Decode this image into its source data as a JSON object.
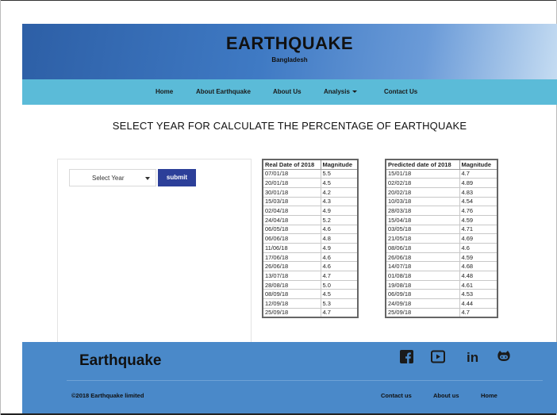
{
  "header": {
    "title": "EARTHQUAKE",
    "subtitle": "Bangladesh"
  },
  "nav": {
    "home": "Home",
    "about_earthquake": "About Earthquake",
    "about_us": "About Us",
    "analysis": "Analysis",
    "contact_us": "Contact Us"
  },
  "main": {
    "heading": "SELECT YEAR FOR CALCULATE THE PERCENTAGE OF EARTHQUAKE",
    "select_value": "Select Year",
    "submit_label": "submit"
  },
  "real_table": {
    "headers": [
      "Real Date of 2018",
      "Magnitude"
    ],
    "rows": [
      [
        "07/01/18",
        "5.5"
      ],
      [
        "20/01/18",
        "4.5"
      ],
      [
        "30/01/18",
        "4.2"
      ],
      [
        "15/03/18",
        "4.3"
      ],
      [
        "02/04/18",
        "4.9"
      ],
      [
        "24/04/18",
        "5.2"
      ],
      [
        "06/05/18",
        "4.6"
      ],
      [
        "06/06/18",
        "4.8"
      ],
      [
        "11/06/18",
        "4.9"
      ],
      [
        "17/06/18",
        "4.6"
      ],
      [
        "26/06/18",
        "4.6"
      ],
      [
        "13/07/18",
        "4.7"
      ],
      [
        "28/08/18",
        "5.0"
      ],
      [
        "08/09/18",
        "4.5"
      ],
      [
        "12/09/18",
        "5.3"
      ],
      [
        "25/09/18",
        "4.7"
      ]
    ]
  },
  "predicted_table": {
    "headers": [
      "Predicted date of 2018",
      "Magnitude"
    ],
    "rows": [
      [
        "15/01/18",
        "4.7"
      ],
      [
        "02/02/18",
        "4.89"
      ],
      [
        "20/02/18",
        "4.83"
      ],
      [
        "10/03/18",
        "4.54"
      ],
      [
        "28/03/18",
        "4.76"
      ],
      [
        "15/04/18",
        "4.59"
      ],
      [
        "03/05/18",
        "4.71"
      ],
      [
        "21/05/18",
        "4.69"
      ],
      [
        "08/06/18",
        "4.6"
      ],
      [
        "26/06/18",
        "4.59"
      ],
      [
        "14/07/18",
        "4.68"
      ],
      [
        "01/08/18",
        "4.48"
      ],
      [
        "19/08/18",
        "4.61"
      ],
      [
        "06/09/18",
        "4.53"
      ],
      [
        "24/09/18",
        "4.44"
      ],
      [
        "25/09/18",
        "4.7"
      ]
    ]
  },
  "footer": {
    "brand": "Earthquake",
    "copyright": "©2018 Earthquake limited",
    "links": {
      "contact": "Contact us",
      "about": "About us",
      "home": "Home"
    },
    "social_icons": [
      "facebook-icon",
      "youtube-icon",
      "linkedin-icon",
      "github-icon"
    ],
    "linkedin_text": "in"
  },
  "colors": {
    "nav_bar": "#5bbbd8",
    "submit_button": "#2c3f99",
    "footer": "#4a89c9",
    "hero_start": "#2d5fa6",
    "hero_end": "#c5dcf2"
  }
}
